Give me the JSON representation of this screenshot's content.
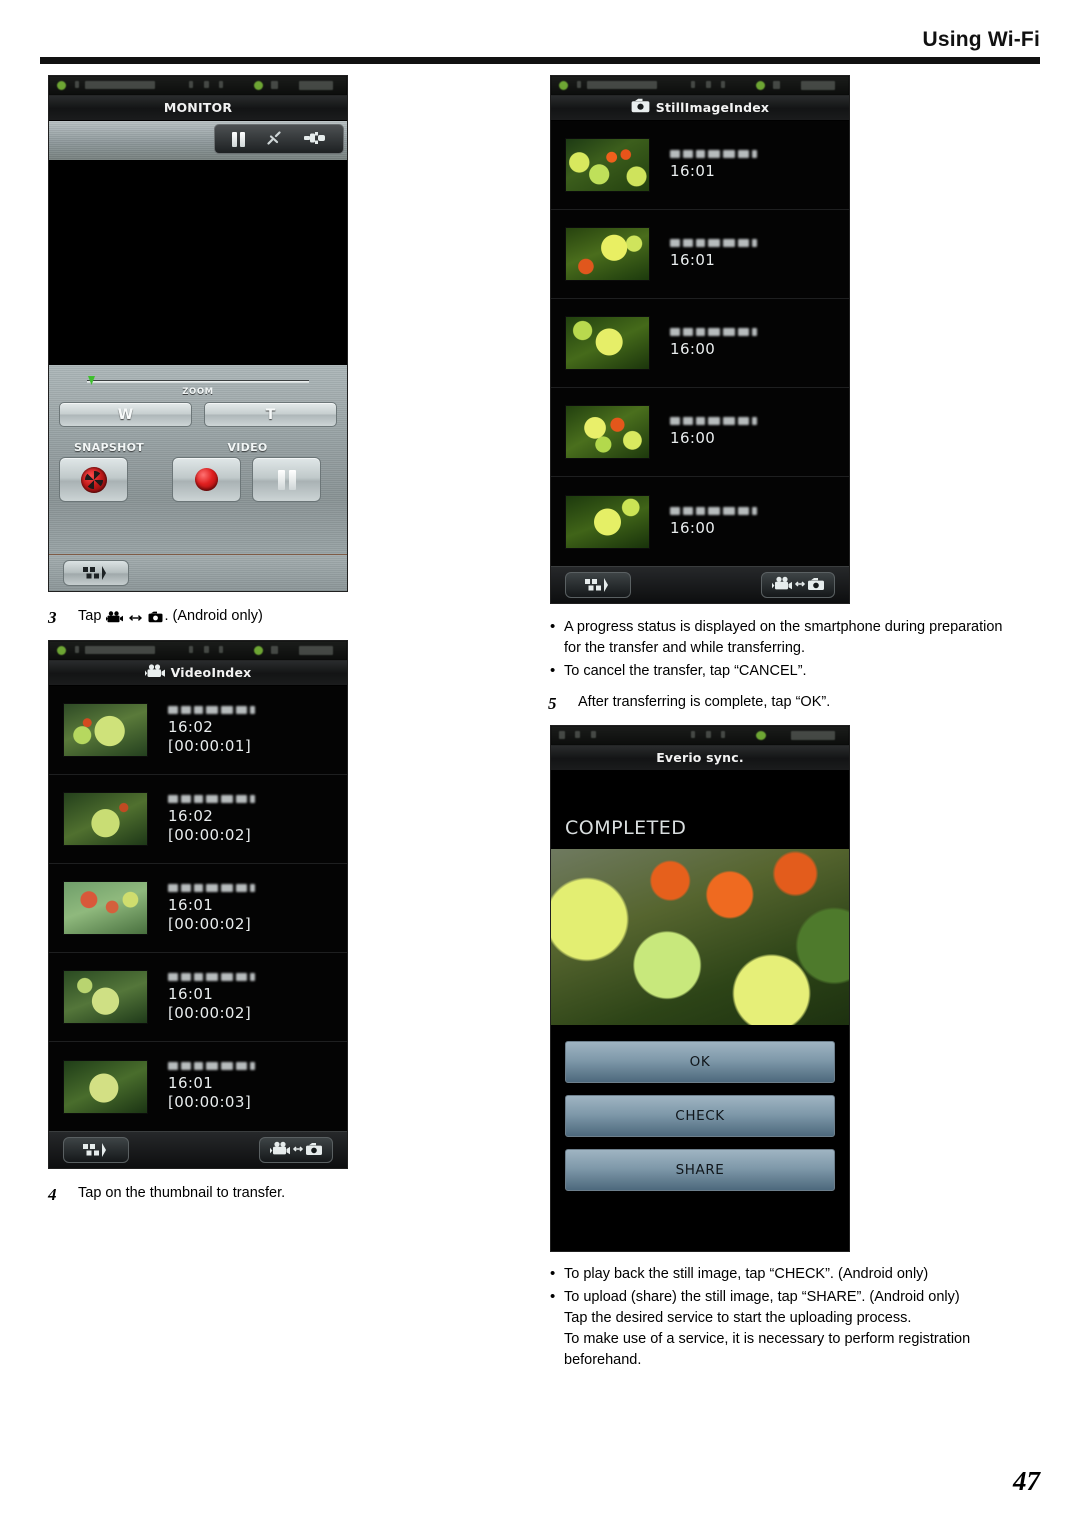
{
  "header": {
    "title": "Using Wi-Fi"
  },
  "page": {
    "number": "47"
  },
  "monitor_screen": {
    "title": "MONITOR",
    "zoom_label": "ZOOM",
    "wide_button": "W",
    "tele_button": "T",
    "snapshot_label": "SNAPSHOT",
    "video_label": "VIDEO",
    "icons": {
      "pause": "pause-icon",
      "link": "link-icon",
      "plug": "plug-icon",
      "index": "index-grid-icon",
      "aperture": "aperture-icon",
      "record": "record-dot-icon"
    }
  },
  "still_image_index": {
    "title": "StillImageIndex",
    "icon": "camera-icon",
    "rows": [
      {
        "time": "16:01",
        "date": "blurred-date"
      },
      {
        "time": "16:01",
        "date": "blurred-date"
      },
      {
        "time": "16:00",
        "date": "blurred-date"
      },
      {
        "time": "16:00",
        "date": "blurred-date"
      },
      {
        "time": "16:00",
        "date": "blurred-date"
      }
    ],
    "toolbar": {
      "index_icon": "index-grid-icon",
      "toggle_icon": "video-camera-toggle-icon"
    }
  },
  "video_index": {
    "title": "VideoIndex",
    "icon": "video-camera-icon",
    "rows": [
      {
        "time": "16:02",
        "duration": "[00:00:01]"
      },
      {
        "time": "16:02",
        "duration": "[00:00:02]"
      },
      {
        "time": "16:01",
        "duration": "[00:00:02]"
      },
      {
        "time": "16:01",
        "duration": "[00:00:02]"
      },
      {
        "time": "16:01",
        "duration": "[00:00:03]"
      }
    ],
    "toolbar": {
      "index_icon": "index-grid-icon",
      "toggle_icon": "video-camera-toggle-icon"
    }
  },
  "everio_sync": {
    "title": "Everio sync.",
    "status": "COMPLETED",
    "buttons": {
      "ok": "OK",
      "check": "CHECK",
      "share": "SHARE"
    }
  },
  "steps": {
    "step3": {
      "number": "3",
      "prefix": "Tap",
      "suffix": ". (Android only)"
    },
    "step4": {
      "number": "4",
      "text": "Tap on the thumbnail to transfer."
    },
    "step5": {
      "number": "5",
      "text": "After transferring is complete, tap “OK”."
    }
  },
  "notes_right_top": [
    {
      "line1": "A progress status is displayed on the smartphone during preparation",
      "line2": "for the transfer and while transferring."
    },
    {
      "line1": "To cancel the transfer, tap “CANCEL”.",
      "line2": ""
    }
  ],
  "notes_right_bottom": [
    {
      "line1": "To play back the still image, tap “CHECK”. (Android only)",
      "line2": "",
      "line3": "",
      "line4": ""
    },
    {
      "line1": "To upload (share) the still image, tap “SHARE”. (Android only)",
      "line2": "Tap the desired service to start the uploading process.",
      "line3": "To make use of a service, it is necessary to perform registration",
      "line4": "beforehand."
    }
  ]
}
